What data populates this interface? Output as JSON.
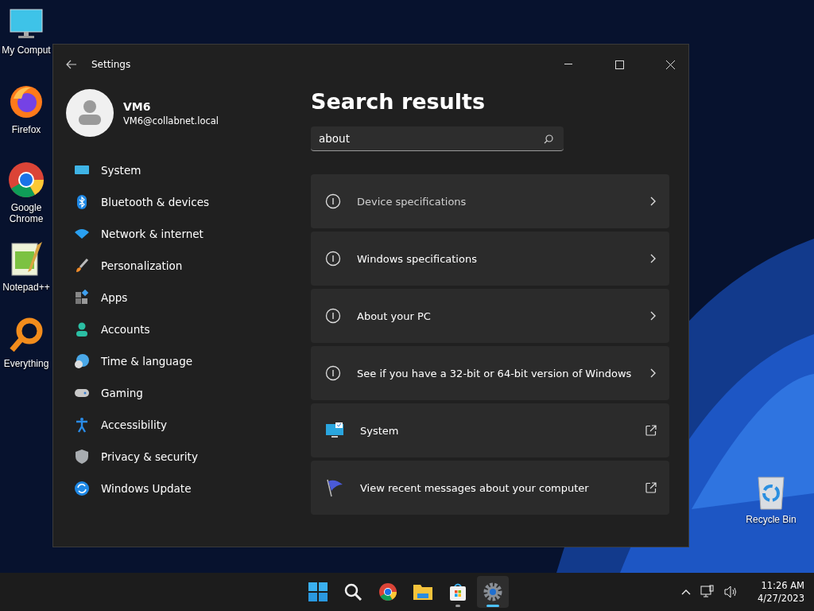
{
  "desktop_icons": [
    {
      "label": "My Comput"
    },
    {
      "label": "Firefox"
    },
    {
      "label": "Google Chrome"
    },
    {
      "label": "Notepad++"
    },
    {
      "label": "Everything"
    },
    {
      "label": "Recycle Bin"
    }
  ],
  "window": {
    "title": "Settings"
  },
  "profile": {
    "name": "VM6",
    "email": "VM6@collabnet.local"
  },
  "sidebar": {
    "items": [
      {
        "label": "System"
      },
      {
        "label": "Bluetooth & devices"
      },
      {
        "label": "Network & internet"
      },
      {
        "label": "Personalization"
      },
      {
        "label": "Apps"
      },
      {
        "label": "Accounts"
      },
      {
        "label": "Time & language"
      },
      {
        "label": "Gaming"
      },
      {
        "label": "Accessibility"
      },
      {
        "label": "Privacy & security"
      },
      {
        "label": "Windows Update"
      }
    ]
  },
  "heading": "Search results",
  "search": {
    "value": "about"
  },
  "results": [
    {
      "label": "Device specifications",
      "kind": "page",
      "hovered": true
    },
    {
      "label": "Windows specifications",
      "kind": "page",
      "hovered": false
    },
    {
      "label": "About your PC",
      "kind": "page",
      "hovered": false
    },
    {
      "label": "See if you have a 32-bit or 64-bit version of Windows",
      "kind": "page",
      "hovered": false
    },
    {
      "label": "System",
      "kind": "external",
      "hovered": false
    },
    {
      "label": "View recent messages about your computer",
      "kind": "external",
      "hovered": false
    }
  ],
  "taskbar": {
    "apps": [
      {
        "running": false,
        "active": false
      },
      {
        "running": false,
        "active": false
      },
      {
        "running": false,
        "active": false
      },
      {
        "running": false,
        "active": false
      },
      {
        "running": true,
        "active": false
      },
      {
        "running": true,
        "active": true
      }
    ],
    "time": "11:26 AM",
    "date": "4/27/2023"
  }
}
